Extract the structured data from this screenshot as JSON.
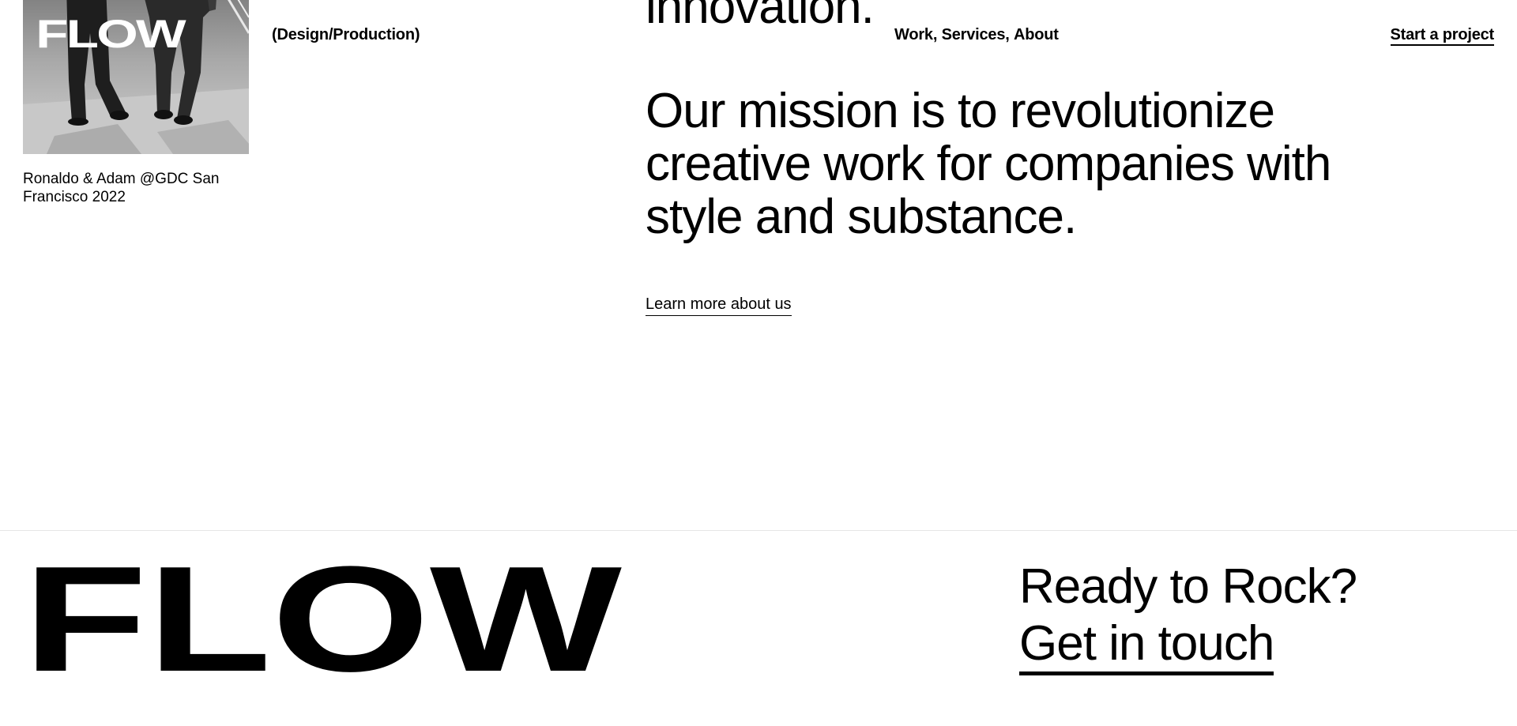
{
  "header": {
    "tagline": "(Design/Production)",
    "nav": [
      {
        "label": "Work"
      },
      {
        "label": "Services"
      },
      {
        "label": "About"
      }
    ],
    "nav_separator": ", ",
    "cta_label": "Start a project"
  },
  "photo": {
    "overlay_text": "FLOW",
    "caption": "Ronaldo & Adam @GDC San Francisco 2022"
  },
  "intro": {
    "heading_tail": "innovation.",
    "mission": "Our mission is to revolutionize creative work for companies with style and substance.",
    "learn_more_label": "Learn more about us"
  },
  "footer": {
    "logo_text": "FLOW",
    "ready_text": "Ready to Rock?",
    "contact_label": "Get in touch"
  },
  "colors": {
    "background": "#ffffff",
    "text": "#000000",
    "divider": "#e6e6e6"
  }
}
